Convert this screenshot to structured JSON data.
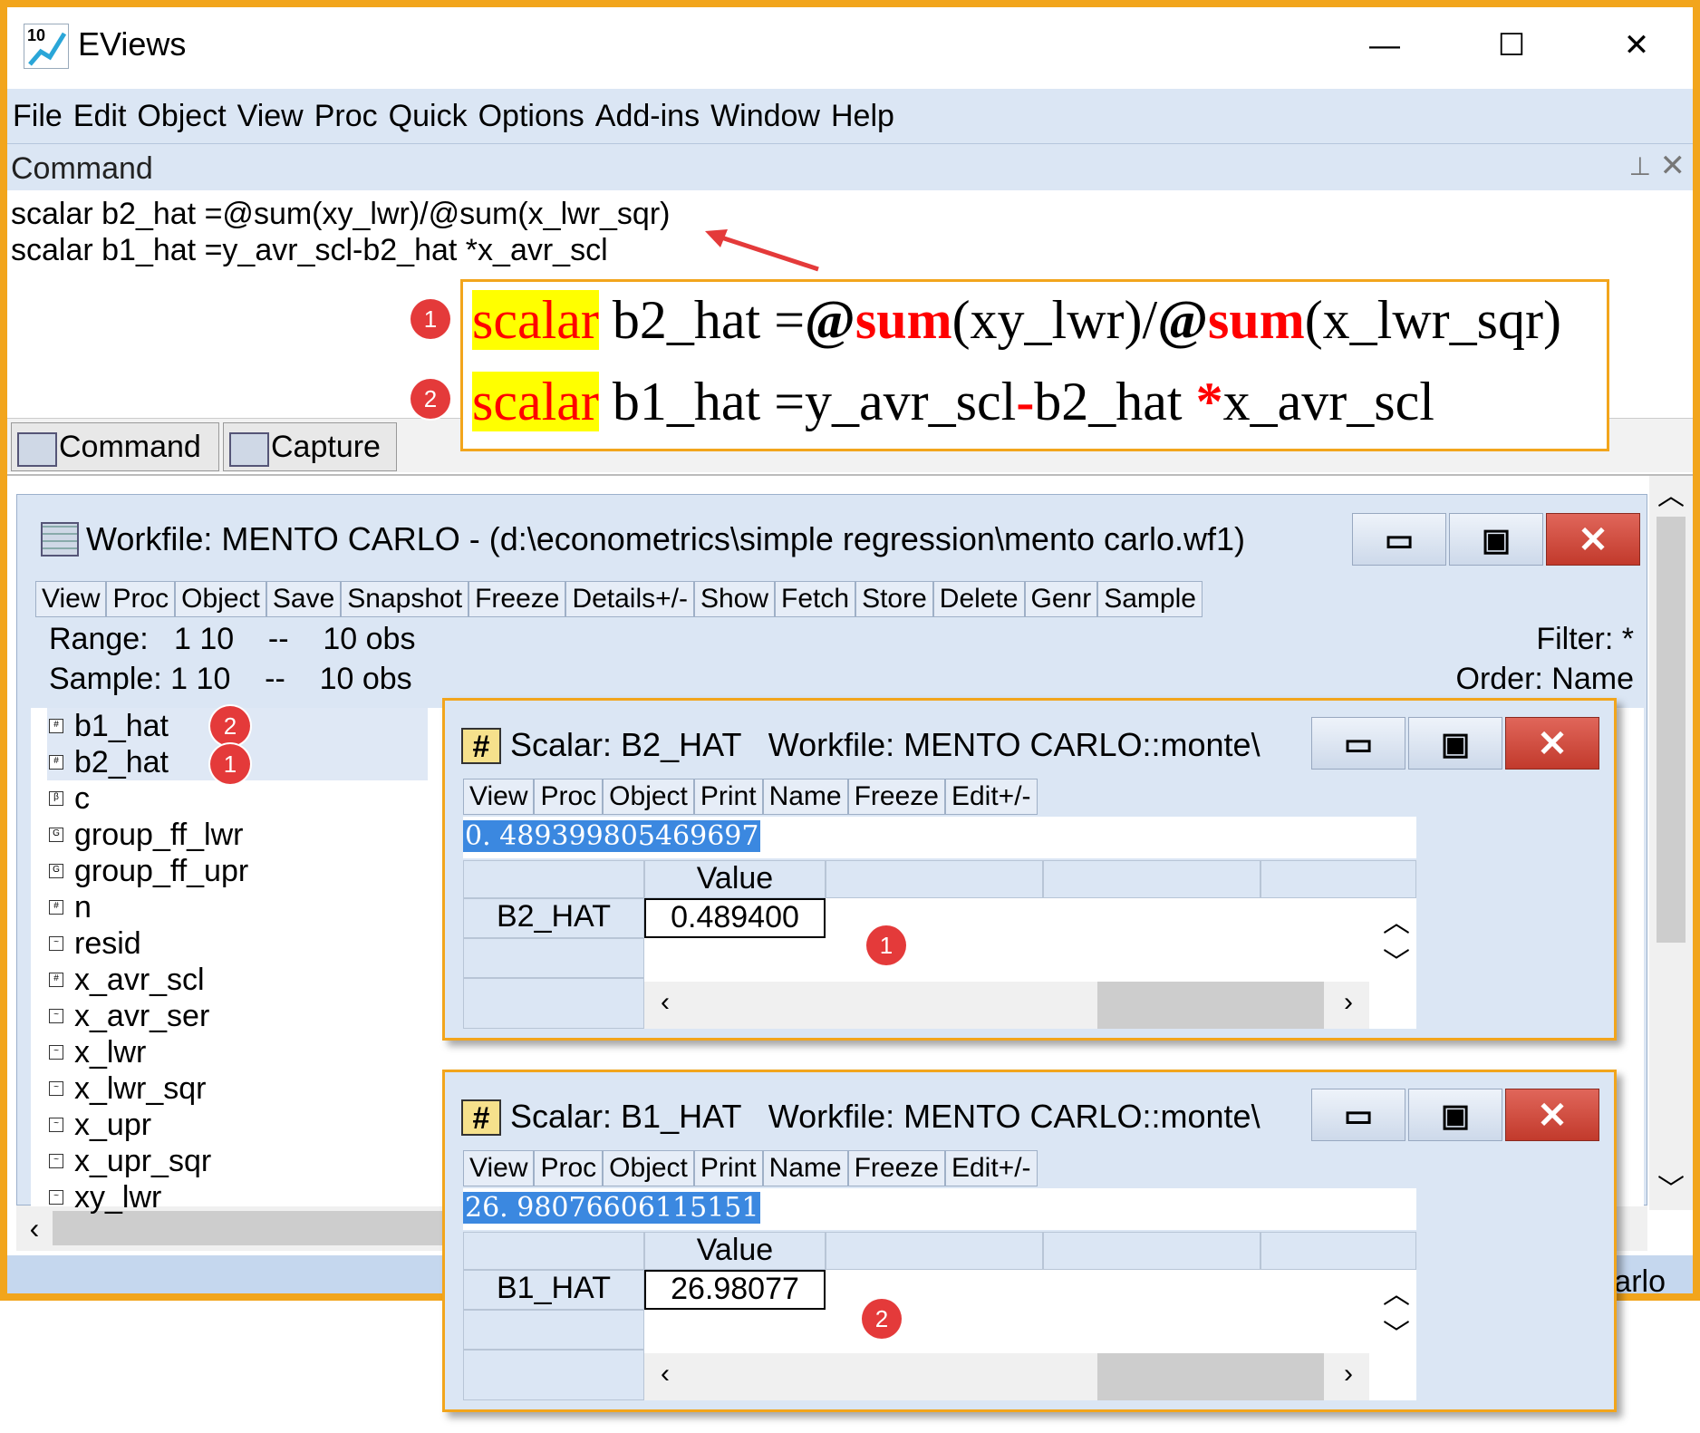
{
  "app": {
    "title": "EViews",
    "logo_text": "10",
    "controls": {
      "minimize": "—",
      "maximize": "☐",
      "close": "✕"
    }
  },
  "menu": [
    "File",
    "Edit",
    "Object",
    "View",
    "Proc",
    "Quick",
    "Options",
    "Add-ins",
    "Window",
    "Help"
  ],
  "command_panel": {
    "title": "Command",
    "lines": [
      "scalar b2_hat =@sum(xy_lwr)/@sum(x_lwr_sqr)",
      "scalar b1_hat =y_avr_scl-b2_hat *x_avr_scl"
    ]
  },
  "annotation": {
    "badge1": "1",
    "badge2": "2",
    "line1": {
      "kw": "scalar",
      "a": " b2_hat =",
      "at1": "@",
      "fn1": "sum",
      "b": "(xy_lwr)/",
      "at2": "@",
      "fn2": "sum",
      "c": "(x_lwr_sqr)"
    },
    "line2": {
      "kw": "scalar",
      "a": " b1_hat =y_avr_scl",
      "minus": "-",
      "b": "b2_hat ",
      "star": "*",
      "c": "x_avr_scl"
    }
  },
  "tabs": [
    "Command",
    "Capture"
  ],
  "workfile": {
    "title": "Workfile: MENTO CARLO - (d:\\econometrics\\simple regression\\mento carlo.wf1)",
    "toolbar": [
      "View",
      "Proc",
      "Object",
      "Save",
      "Snapshot",
      "Freeze",
      "Details+/-",
      "Show",
      "Fetch",
      "Store",
      "Delete",
      "Genr",
      "Sample"
    ],
    "range": "Range:   1 10    --    10 obs",
    "sample": "Sample: 1 10    --    10 obs",
    "filter": "Filter: *",
    "order": "Order: Name",
    "items": [
      {
        "name": "b1_hat",
        "icon": "scalar-icon",
        "badge": "2"
      },
      {
        "name": "b2_hat",
        "icon": "scalar-icon",
        "badge": "1"
      },
      {
        "name": "c",
        "icon": "coef-icon"
      },
      {
        "name": "group_ff_lwr",
        "icon": "group-icon"
      },
      {
        "name": "group_ff_upr",
        "icon": "group-icon"
      },
      {
        "name": "n",
        "icon": "scalar-icon"
      },
      {
        "name": "resid",
        "icon": "series-icon"
      },
      {
        "name": "x_avr_scl",
        "icon": "scalar-icon"
      },
      {
        "name": "x_avr_ser",
        "icon": "series-icon"
      },
      {
        "name": "x_lwr",
        "icon": "series-icon"
      },
      {
        "name": "x_lwr_sqr",
        "icon": "series-icon"
      },
      {
        "name": "x_upr",
        "icon": "series-icon"
      },
      {
        "name": "x_upr_sqr",
        "icon": "series-icon"
      },
      {
        "name": "xy_lwr",
        "icon": "series-icon"
      }
    ]
  },
  "scalar_windows": [
    {
      "title": "Scalar: B2_HAT   Workfile: MENTO CARLO::monte\\",
      "toolbar": [
        "View",
        "Proc",
        "Object",
        "Print",
        "Name",
        "Freeze",
        "Edit+/-"
      ],
      "full_value": "0. 489399805469697",
      "column_header": "Value",
      "row_label": "B2_HAT",
      "value": "0.489400",
      "badge": "1"
    },
    {
      "title": "Scalar: B1_HAT   Workfile: MENTO CARLO::monte\\",
      "toolbar": [
        "View",
        "Proc",
        "Object",
        "Print",
        "Name",
        "Freeze",
        "Edit+/-"
      ],
      "full_value": "26. 98076606115151",
      "column_header": "Value",
      "row_label": "B1_HAT",
      "value": "26.98077",
      "badge": "2"
    }
  ],
  "status": {
    "text": "arlo"
  },
  "colors": {
    "highlight_border": "#f2a51c",
    "badge": "#e43a3a",
    "keyword": "#ff0000",
    "keyword_bg": "#ffff00",
    "selection": "#3b88e0"
  }
}
